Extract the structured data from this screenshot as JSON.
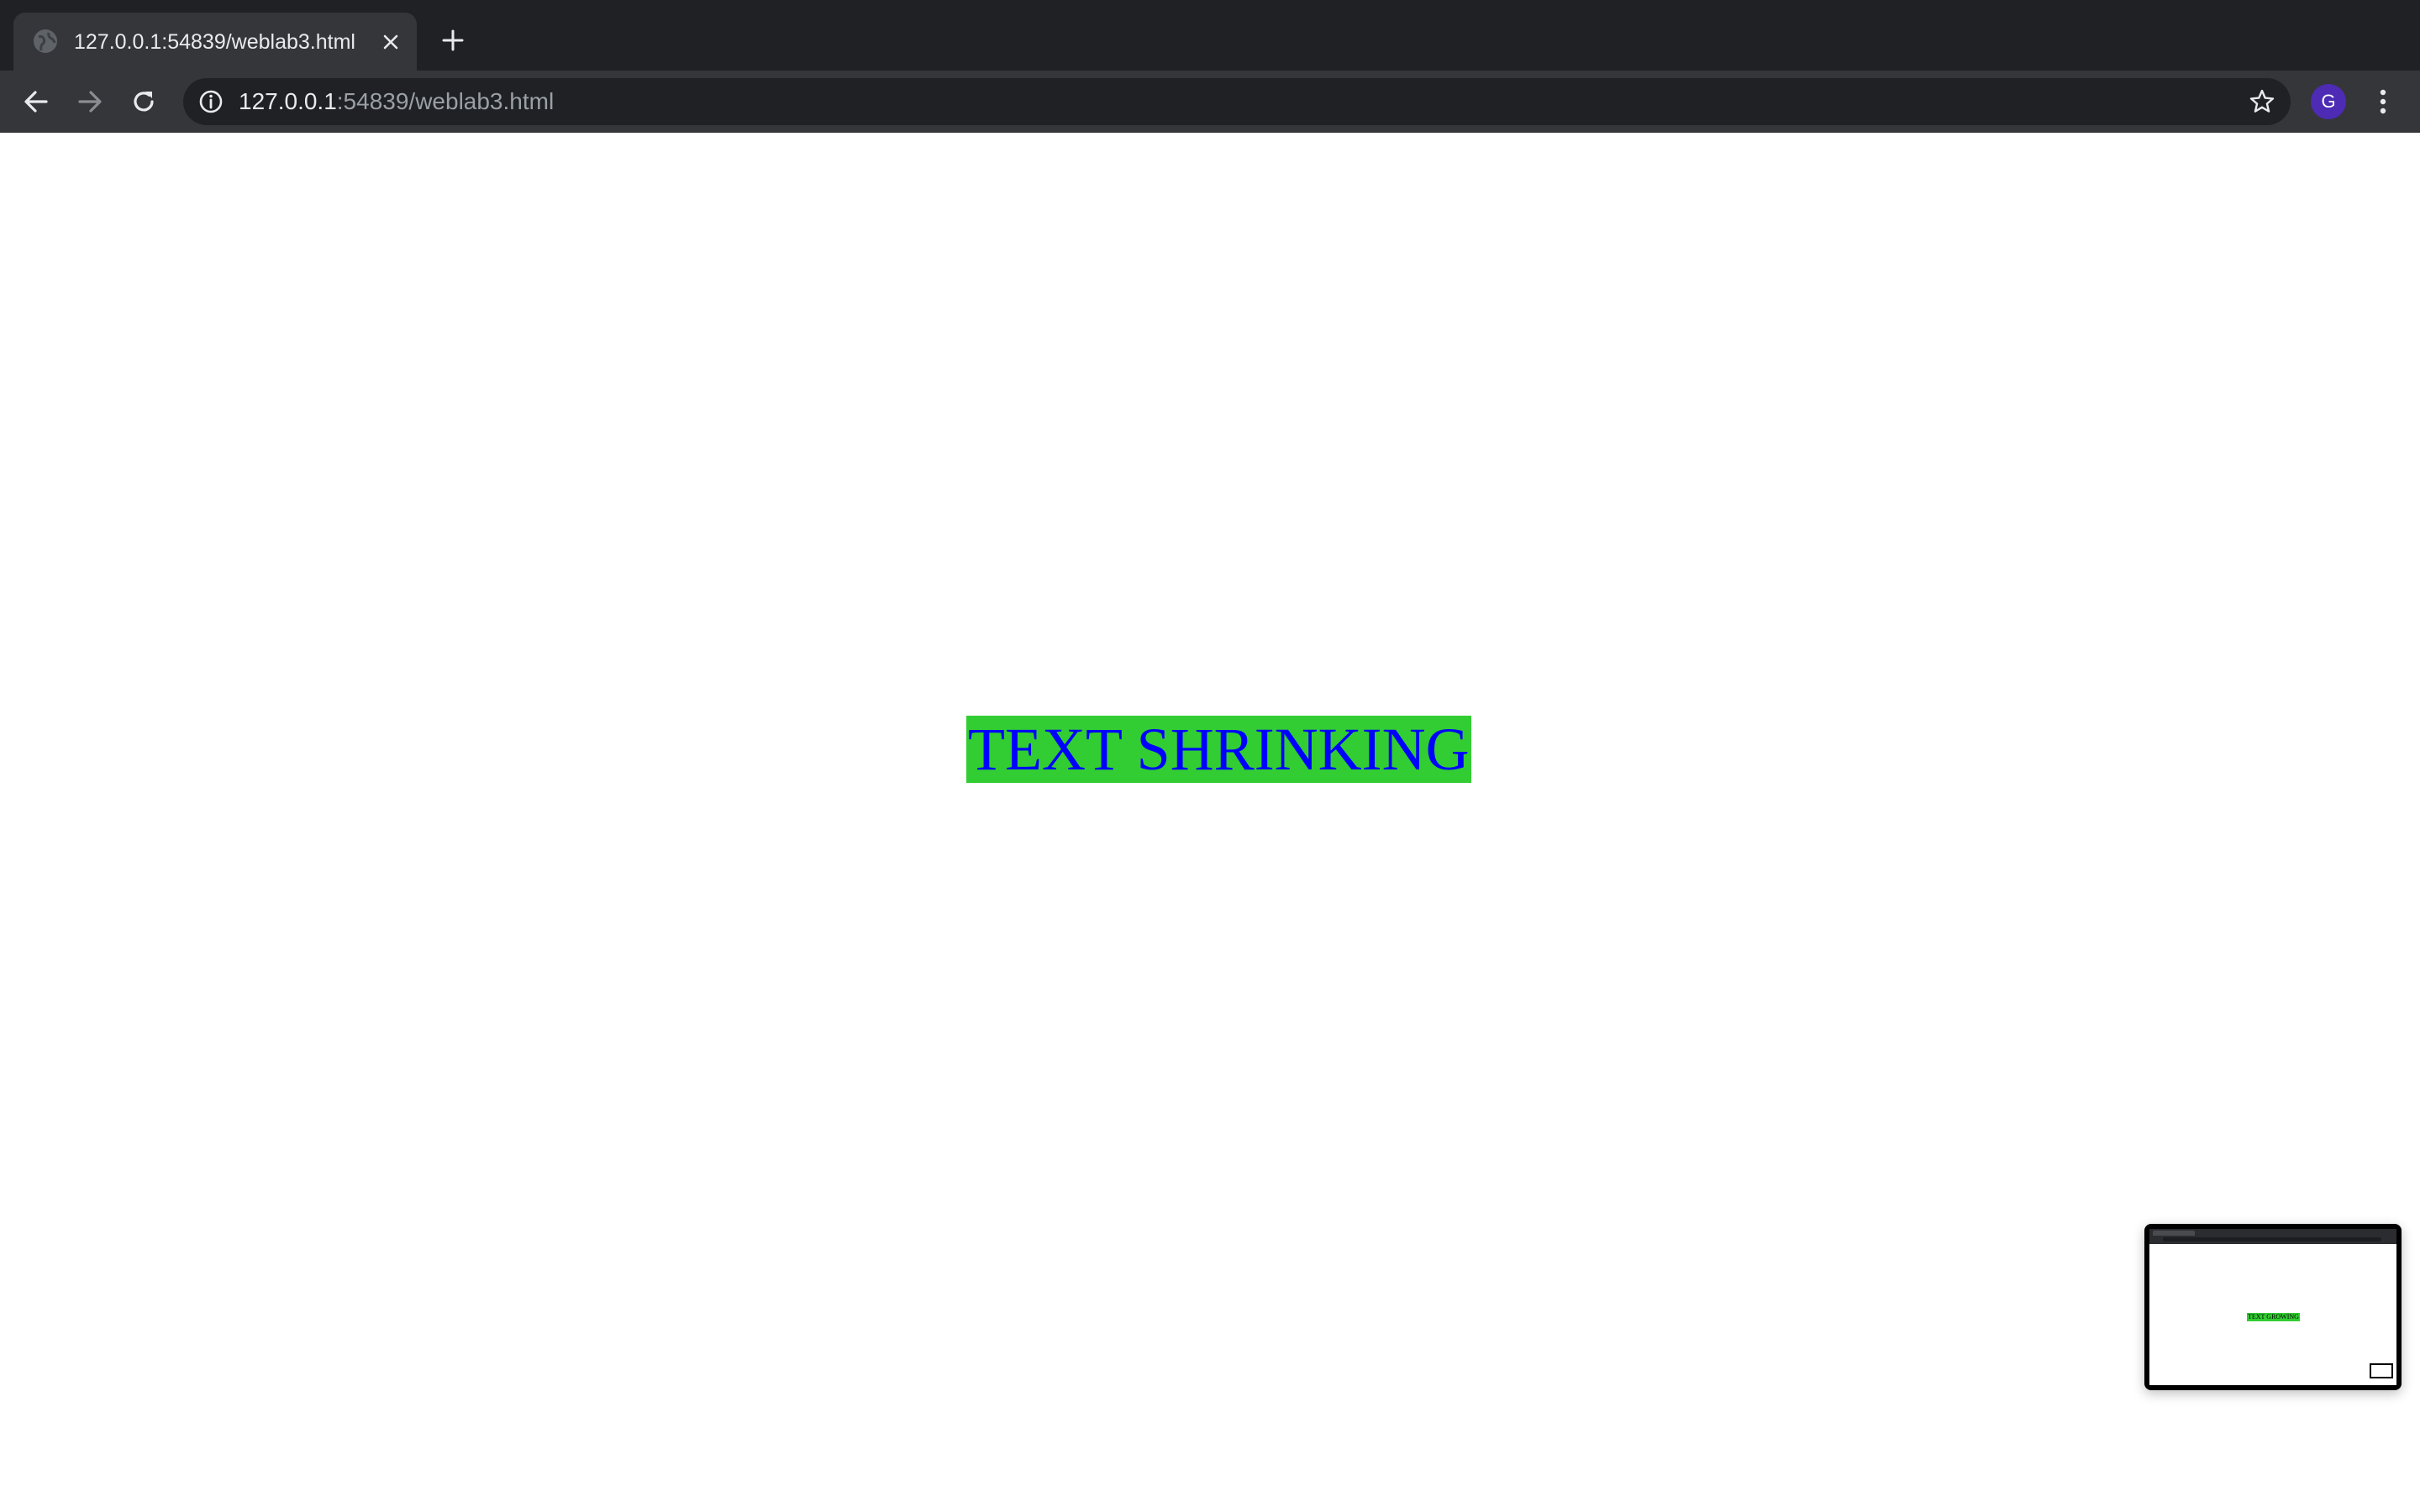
{
  "browser": {
    "tab": {
      "title": "127.0.0.1:54839/weblab3.html",
      "favicon": "globe-icon",
      "close": "close-icon"
    },
    "new_tab": "plus-icon",
    "toolbar": {
      "back": "arrow-left-icon",
      "forward": "arrow-right-icon",
      "reload": "reload-icon",
      "address": {
        "host": "127.0.0.1",
        "rest": ":54839/weblab3.html"
      },
      "bookmark": "star-icon",
      "profile_initial": "G",
      "menu": "kebab-menu-icon"
    },
    "colors": {
      "tabstrip": "#202124",
      "active_tab": "#35363a",
      "avatar": "#4d2bb5"
    }
  },
  "page": {
    "text": "TEXT SHRINKING",
    "text_color": "#0000ff",
    "highlight_color": "#32cd32"
  },
  "thumbnail": {
    "label": "TEXT GROWING"
  }
}
